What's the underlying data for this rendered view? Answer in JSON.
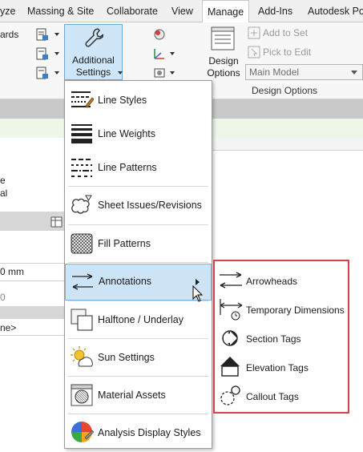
{
  "tabs": [
    {
      "label": "yze",
      "active": false
    },
    {
      "label": "Massing & Site",
      "active": false
    },
    {
      "label": "Collaborate",
      "active": false
    },
    {
      "label": "View",
      "active": false
    },
    {
      "label": "Manage",
      "active": true
    },
    {
      "label": "Add-Ins",
      "active": false
    },
    {
      "label": "Autodesk Poi",
      "active": false
    }
  ],
  "ribbon": {
    "left_fragment": "ards",
    "additional_settings": {
      "line1": "Additional",
      "line2": "Settings",
      "icon": "wrench-icon"
    },
    "design_options_button": {
      "line1": "Design",
      "line2": "Options",
      "icon": "design-options-icon"
    },
    "add_to_set": "Add to Set",
    "pick_to_edit": "Pick to Edit",
    "main_model": "Main Model",
    "panel_label": "Design Options"
  },
  "background": {
    "left_fragments": [
      "e",
      "al",
      "0 mm",
      "0",
      "ne>"
    ]
  },
  "menu": {
    "items": [
      {
        "label": "Line Styles",
        "icon": "line-styles-icon"
      },
      {
        "label": "Line Weights",
        "icon": "line-weights-icon"
      },
      {
        "label": "Line Patterns",
        "icon": "line-patterns-icon"
      },
      {
        "label": "Sheet Issues/Revisions",
        "icon": "revision-cloud-icon"
      },
      {
        "label": "Fill Patterns",
        "icon": "fill-patterns-icon"
      },
      {
        "label": "Annotations",
        "icon": "annotations-icon",
        "highlighted": true,
        "has_submenu": true
      },
      {
        "label": "Halftone / Underlay",
        "icon": "halftone-icon"
      },
      {
        "label": "Sun Settings",
        "icon": "sun-settings-icon"
      },
      {
        "label": "Material Assets",
        "icon": "material-assets-icon"
      },
      {
        "label": "Analysis Display Styles",
        "icon": "analysis-display-icon"
      }
    ]
  },
  "submenu": {
    "items": [
      {
        "label": "Arrowheads",
        "icon": "arrowheads-icon"
      },
      {
        "label": "Temporary Dimensions",
        "icon": "temporary-dimensions-icon"
      },
      {
        "label": "Section Tags",
        "icon": "section-tag-icon"
      },
      {
        "label": "Elevation Tags",
        "icon": "elevation-tag-icon"
      },
      {
        "label": "Callout Tags",
        "icon": "callout-tag-icon"
      }
    ],
    "highlight_color": "#d9414b"
  },
  "colors": {
    "accent_highlight": "#cde4f7",
    "accent_border": "#7fb1dc",
    "green_band": "#eef6e8"
  }
}
